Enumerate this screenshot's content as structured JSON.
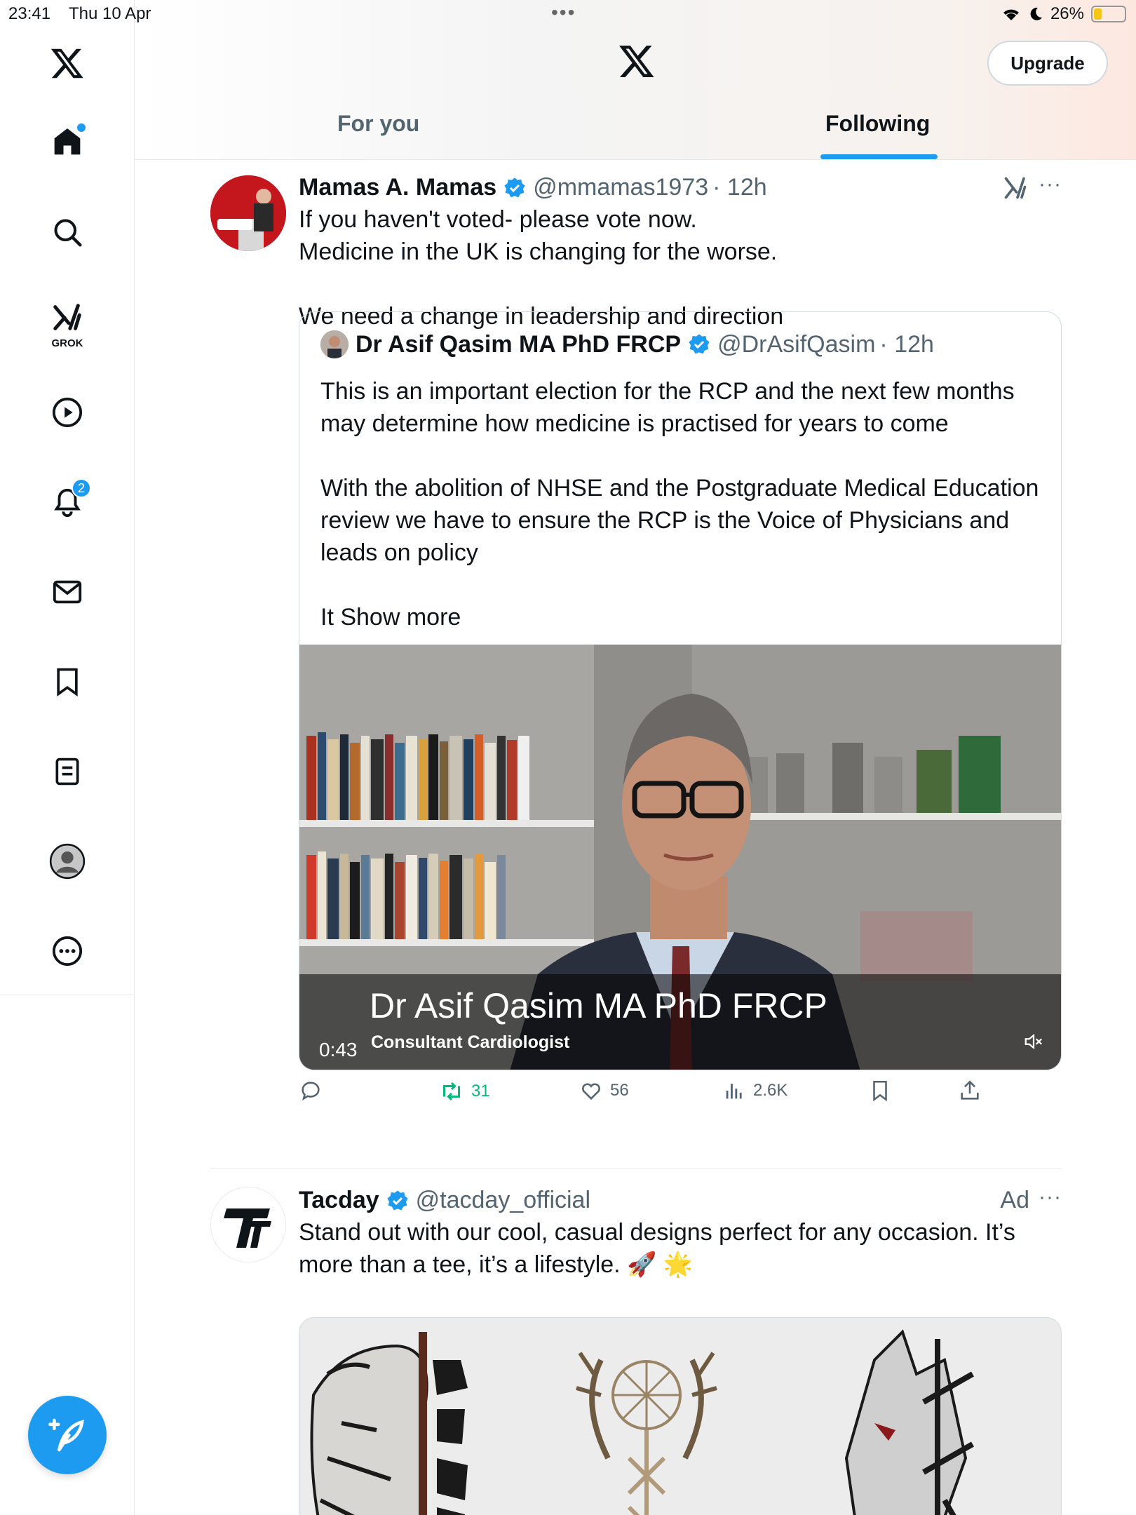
{
  "status_bar": {
    "time": "23:41",
    "date": "Thu 10 Apr",
    "battery": "26%",
    "battery_level": 0.26
  },
  "sidebar": {
    "grok_label": "GROK",
    "notifications_count": "2",
    "items": [
      "x-logo",
      "home-icon",
      "search-icon",
      "grok-icon",
      "video-icon",
      "notifications-icon",
      "messages-icon",
      "bookmarks-icon",
      "lists-icon",
      "profile-icon",
      "more-icon"
    ]
  },
  "header": {
    "upgrade_label": "Upgrade",
    "tabs": [
      {
        "label": "For you",
        "active": false
      },
      {
        "label": "Following",
        "active": true
      }
    ]
  },
  "tweet1": {
    "name": "Mamas A. Mamas",
    "handle": "@mmamas1973",
    "time": "· 12h",
    "text": "If you haven't voted- please vote now.\nMedicine in the UK is changing for the worse.\n\nWe need a change in leadership and direction",
    "quote": {
      "name": "Dr Asif Qasim MA PhD FRCP",
      "handle": "@DrAsifQasim",
      "time": "· 12h",
      "text": "This is an important election for the RCP and the next few months may determine how medicine is practised for years to come\n\nWith the abolition of NHSE and the Postgraduate Medical Education review we have to ensure the RCP is the Voice of Physicians and leads on policy\n\nIt Show more",
      "video": {
        "caption_name": "Dr Asif Qasim MA PhD FRCP",
        "caption_role": "Consultant Cardiologist",
        "duration": "0:43"
      }
    },
    "actions": {
      "replies": "",
      "retweets": "31",
      "likes": "56",
      "views": "2.6K"
    }
  },
  "tweet2": {
    "name": "Tacday",
    "handle": "@tacday_official",
    "ad_label": "Ad",
    "text": "Stand out with our cool, casual designs perfect for any occasion. It’s more than a tee, it’s a lifestyle. 🚀 🌟"
  },
  "colors": {
    "accent": "#1d9bf0",
    "retweet": "#00ba7c",
    "muted": "#536471"
  }
}
